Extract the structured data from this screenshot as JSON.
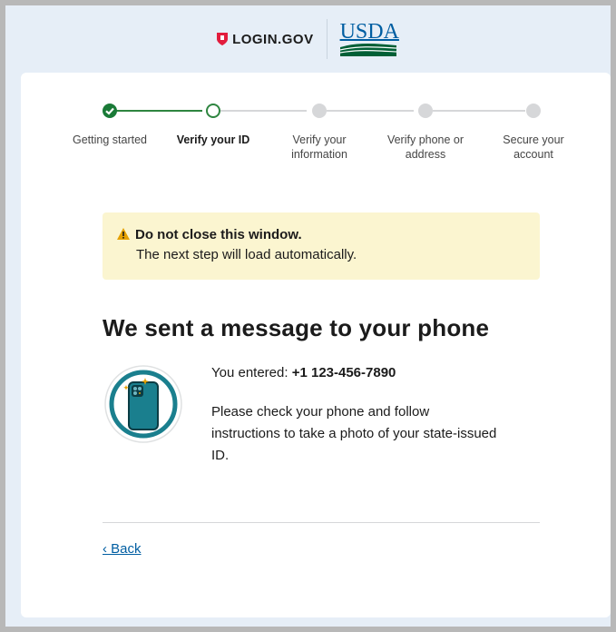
{
  "header": {
    "login_brand": "LOGIN.GOV",
    "partner_brand": "USDA"
  },
  "steps": [
    {
      "label": "Getting started",
      "state": "done"
    },
    {
      "label": "Verify your ID",
      "state": "current"
    },
    {
      "label": "Verify your information",
      "state": "future"
    },
    {
      "label": "Verify phone or address",
      "state": "future"
    },
    {
      "label": "Secure your account",
      "state": "future"
    }
  ],
  "alert": {
    "title": "Do not close this window.",
    "body": "The next step will load automatically."
  },
  "main": {
    "title": "We sent a message to your phone",
    "entered_prefix": "You entered: ",
    "phone_number": "+1 123-456-7890",
    "instructions": "Please check your phone and follow instructions to take a photo of your state-issued ID."
  },
  "nav": {
    "back_label": "‹ Back"
  },
  "colors": {
    "brand_green": "#2e8540",
    "link_blue": "#005ea2",
    "alert_bg": "#fbf5d0",
    "login_red": "#e21c3d"
  }
}
